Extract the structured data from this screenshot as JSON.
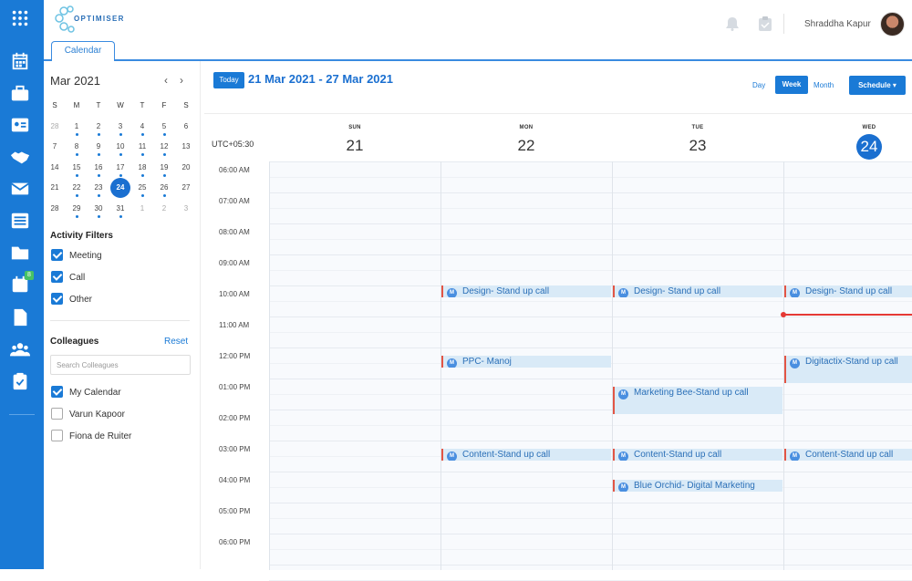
{
  "header": {
    "logo_text": "OPTIMISER",
    "user_name": "Shraddha Kapur"
  },
  "tabs": [
    {
      "label": "Calendar"
    }
  ],
  "mini_calendar": {
    "title": "Mar 2021",
    "weekday_headers": [
      "S",
      "M",
      "T",
      "W",
      "T",
      "F",
      "S"
    ],
    "weeks": [
      [
        "28",
        "1",
        "2",
        "3",
        "4",
        "5",
        "6"
      ],
      [
        "7",
        "8",
        "9",
        "10",
        "11",
        "12",
        "13"
      ],
      [
        "14",
        "15",
        "16",
        "17",
        "18",
        "19",
        "20"
      ],
      [
        "21",
        "22",
        "23",
        "24",
        "25",
        "26",
        "27"
      ],
      [
        "28",
        "29",
        "30",
        "31",
        "1",
        "2",
        "3"
      ]
    ],
    "today": "24"
  },
  "activity_filters": {
    "title": "Activity Filters",
    "items": [
      {
        "label": "Meeting",
        "checked": true
      },
      {
        "label": "Call",
        "checked": true
      },
      {
        "label": "Other",
        "checked": true
      }
    ]
  },
  "colleagues": {
    "title": "Colleagues",
    "reset_label": "Reset",
    "search_placeholder": "Search Colleagues",
    "items": [
      {
        "label": "My Calendar",
        "checked": true
      },
      {
        "label": "Varun Kapoor",
        "checked": false
      },
      {
        "label": "Fiona de Ruiter",
        "checked": false
      }
    ]
  },
  "toolbar": {
    "today_label": "Today",
    "date_range": "21 Mar 2021 - 27 Mar 2021",
    "view_day": "Day",
    "view_week": "Week",
    "view_month": "Month",
    "schedule_label": "Schedule ▾"
  },
  "week": {
    "timezone": "UTC+05:30",
    "days": [
      {
        "name": "SUN",
        "date": "21"
      },
      {
        "name": "MON",
        "date": "22"
      },
      {
        "name": "TUE",
        "date": "23"
      },
      {
        "name": "WED",
        "date": "24",
        "current": true
      }
    ],
    "times": [
      "06:00 AM",
      "07:00 AM",
      "08:00 AM",
      "09:00 AM",
      "10:00 AM",
      "11:00 AM",
      "12:00 PM",
      "01:00 PM",
      "02:00 PM",
      "03:00 PM",
      "04:00 PM",
      "05:00 PM",
      "06:00 PM"
    ]
  },
  "events": [
    {
      "title": "Design- Stand up call",
      "badge": "M",
      "day": 1,
      "start": 10.0,
      "end": 10.2
    },
    {
      "title": "Design- Stand up call",
      "badge": "M",
      "day": 2,
      "start": 10.0,
      "end": 10.2
    },
    {
      "title": "Design- Stand up call",
      "badge": "M",
      "day": 3,
      "start": 10.0,
      "end": 10.2
    },
    {
      "title": "PPC- Manoj",
      "badge": "M",
      "day": 1,
      "start": 12.25,
      "end": 12.7
    },
    {
      "title": "Digitactix-Stand up call",
      "badge": "M",
      "day": 3,
      "start": 12.25,
      "end": 13.0
    },
    {
      "title": "Marketing Bee-Stand up call",
      "badge": "M",
      "day": 2,
      "start": 13.25,
      "end": 14.0
    },
    {
      "title": "Content-Stand up call",
      "badge": "M",
      "day": 1,
      "start": 15.25,
      "end": 15.7
    },
    {
      "title": "Content-Stand up call",
      "badge": "M",
      "day": 2,
      "start": 15.25,
      "end": 15.7
    },
    {
      "title": "Content-Stand up call",
      "badge": "M",
      "day": 3,
      "start": 15.25,
      "end": 15.7
    },
    {
      "title": "Blue Orchid- Digital Marketing",
      "badge": "M",
      "day": 2,
      "start": 16.25,
      "end": 16.7
    }
  ],
  "now_time": 10.9,
  "colors": {
    "accent": "#1a7ad6",
    "rail": "#1a7ad6",
    "event_bg": "#d9eaf7",
    "event_border": "#e25545",
    "now_line": "#e53935"
  }
}
